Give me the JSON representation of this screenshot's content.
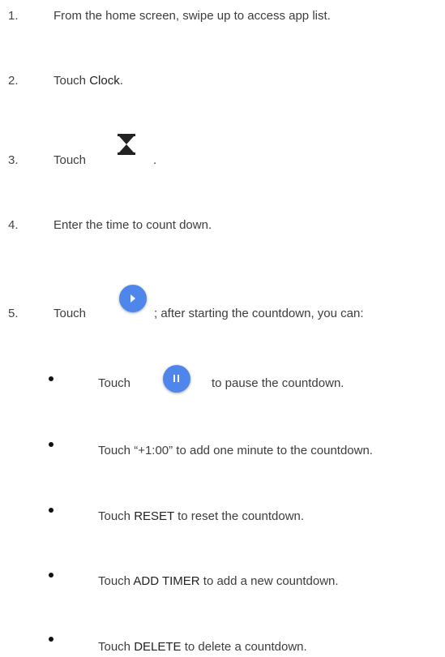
{
  "steps": [
    {
      "num": "1.",
      "text": "From the home screen, swipe up to access app list."
    },
    {
      "num": "2.",
      "pre": "Touch ",
      "bold": "Clock",
      "post": "."
    },
    {
      "num": "3.",
      "pre": "Touch",
      "icon": "hourglass-icon",
      "post": "."
    },
    {
      "num": "4.",
      "text": "Enter the time to count down."
    },
    {
      "num": "5.",
      "pre": "Touch",
      "icon": "play-button-icon",
      "post": "; after starting the countdown, you can:"
    }
  ],
  "bullets": [
    {
      "pre": "Touch",
      "icon": "pause-button-icon",
      "post": "to pause the countdown."
    },
    {
      "text": "Touch “+1:00” to add one minute to the countdown."
    },
    {
      "pre": "Touch ",
      "bold": "RESET",
      "post": " to reset the countdown."
    },
    {
      "pre": "Touch ",
      "bold": "ADD TIMER",
      "post": " to add a new countdown."
    },
    {
      "pre": "Touch ",
      "bold": "DELETE",
      "post": " to delete a countdown."
    }
  ],
  "colors": {
    "accent": "#4f86ec",
    "text": "#3d3d3d",
    "icon_dark": "#222222"
  }
}
